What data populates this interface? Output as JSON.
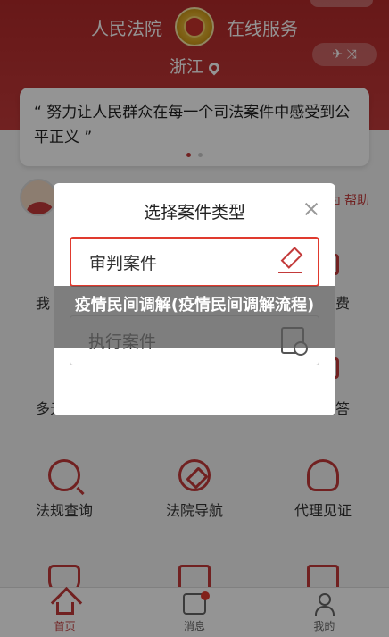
{
  "header": {
    "title_left": "人民法院",
    "title_right": "在线服务",
    "location": "浙江",
    "pill_icons": "✈ ⤨"
  },
  "quote": {
    "text": "“ 努力让人民群众在每一个司法案件中感受到公平正义 ”"
  },
  "help": {
    "label": "帮助",
    "icon": "help-icon"
  },
  "background_items": {
    "row1_left": "我",
    "row1_right": "缴费",
    "row2_left": "多元",
    "row2_right": "问答",
    "grid": [
      {
        "label": "法规查询",
        "icon": "search-icon"
      },
      {
        "label": "法院导航",
        "icon": "compass-icon"
      },
      {
        "label": "代理见证",
        "icon": "person-video-icon"
      }
    ]
  },
  "modal": {
    "title": "选择案件类型",
    "options": [
      {
        "label": "审判案件",
        "icon": "gavel-icon"
      },
      {
        "label": "执行案件",
        "icon": "document-search-icon"
      }
    ]
  },
  "banner": {
    "text": "疫情民间调解(疫情民间调解流程)"
  },
  "tabbar": {
    "tabs": [
      {
        "label": "首页",
        "icon": "home-icon",
        "active": true
      },
      {
        "label": "消息",
        "icon": "message-icon",
        "badge": true
      },
      {
        "label": "我的",
        "icon": "user-icon"
      }
    ]
  },
  "colors": {
    "brand_red": "#c33a3a",
    "highlight_border": "#e03a2e",
    "overlay": "rgba(0,0,0,0.42)"
  }
}
